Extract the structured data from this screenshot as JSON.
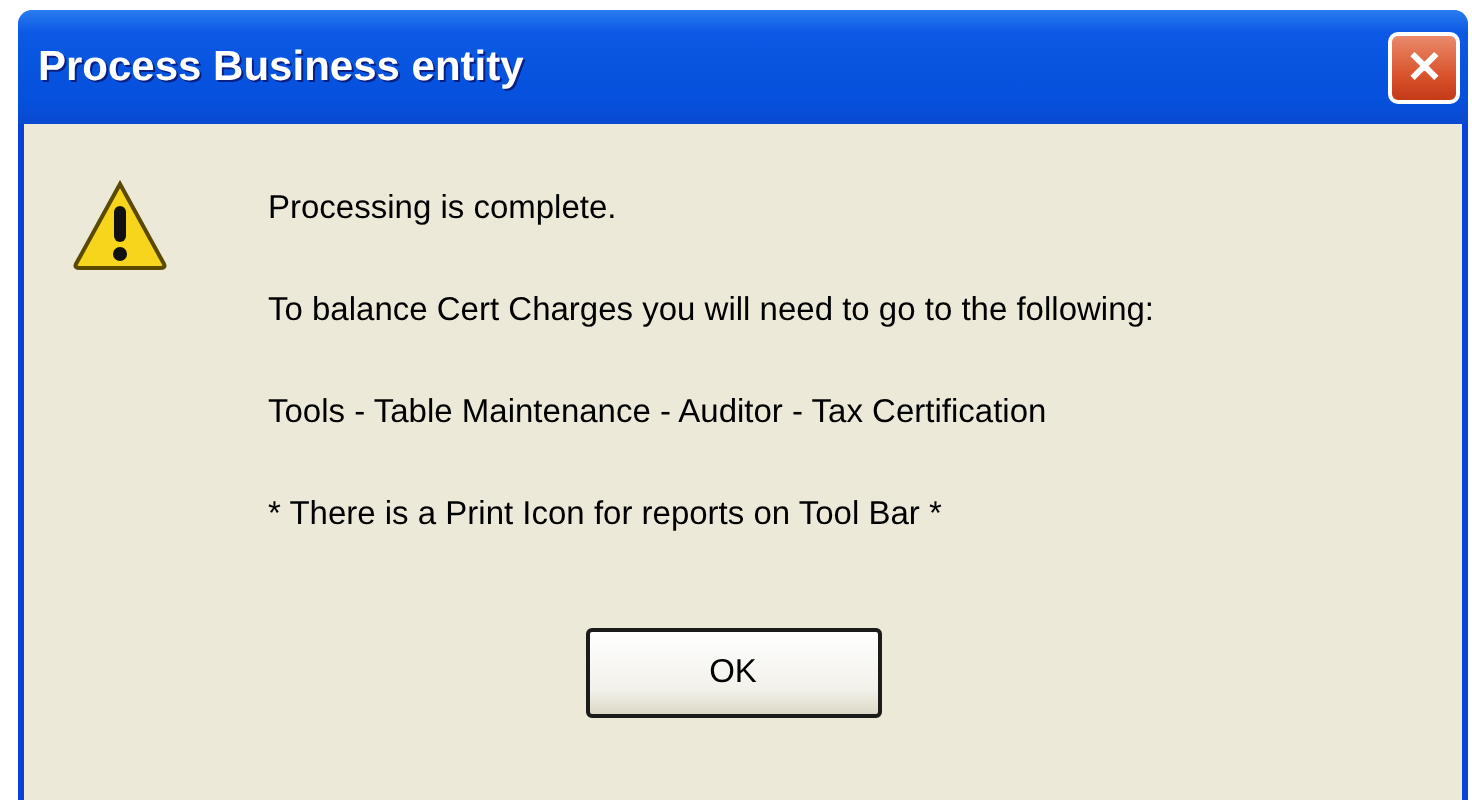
{
  "window": {
    "title": "Process Business entity",
    "close": "✕"
  },
  "messages": [
    "Processing is complete.",
    "To balance Cert Charges you will need to go to the following:",
    "Tools - Table Maintenance - Auditor - Tax Certification",
    "* There is a Print Icon for reports on Tool Bar *"
  ],
  "buttons": [
    {
      "label": "OK"
    }
  ]
}
